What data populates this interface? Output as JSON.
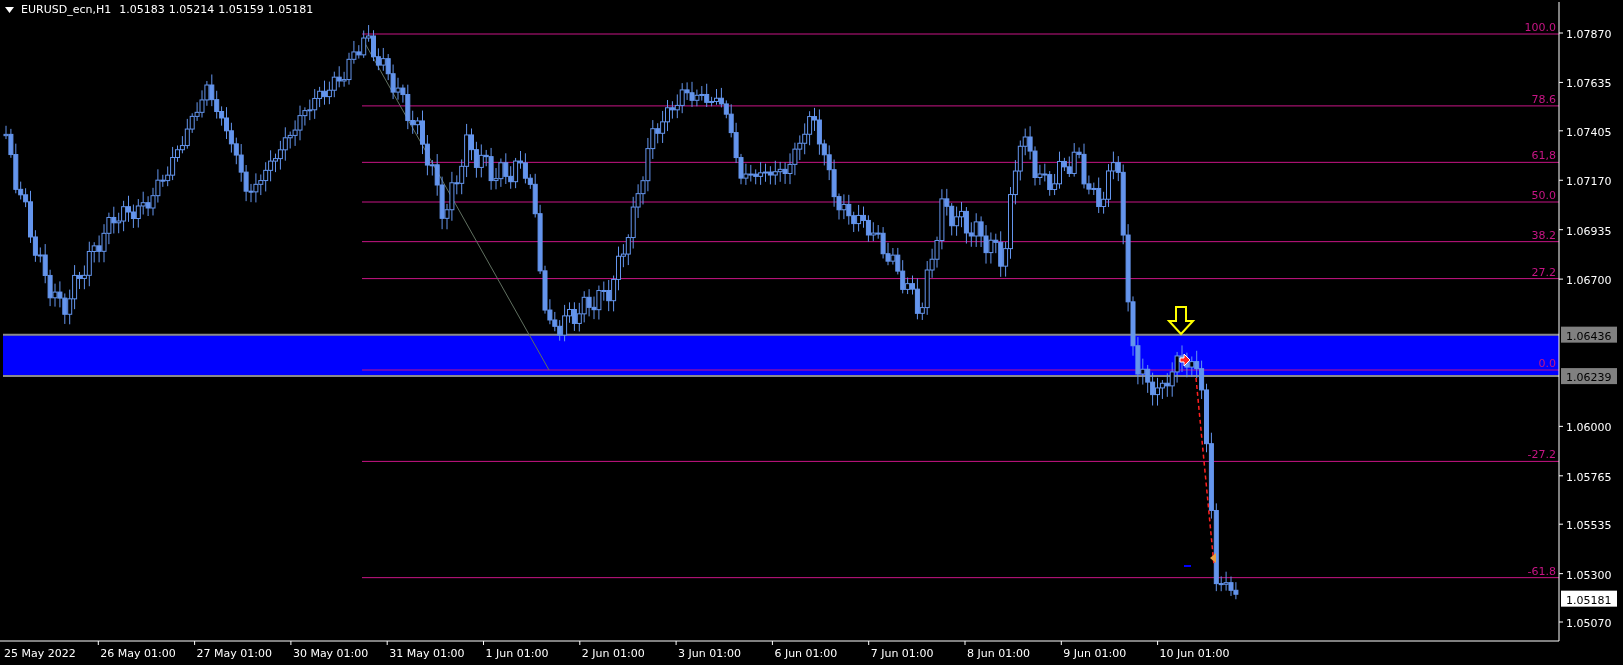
{
  "header": {
    "symbol": "EURUSD_ecn,H1",
    "quotes": [
      "1.05183",
      "1.05214",
      "1.05159",
      "1.05181"
    ]
  },
  "fibonacci_levels": [
    "100.0",
    "78.6",
    "61,8",
    "50.0",
    "38.2",
    "27.2",
    "0.0",
    "-27.2",
    "-61.8"
  ],
  "price_axis": {
    "ticks": [
      "1.07870",
      "1.07635",
      "1.07405",
      "1.07170",
      "1.06935",
      "1.06700",
      "1.06000",
      "1.05765",
      "1.05535",
      "1.05300",
      "1.05070"
    ]
  },
  "price_labels": [
    {
      "text": "1.06436",
      "kind": "line"
    },
    {
      "text": "1.06239",
      "kind": "line"
    },
    {
      "text": "1.05181",
      "kind": "bid"
    }
  ],
  "time_axis": [
    "25 May 2022",
    "26 May 01:00",
    "27 May 01:00",
    "30 May 01:00",
    "31 May 01:00",
    "1 Jun 01:00",
    "2 Jun 01:00",
    "3 Jun 01:00",
    "6 Jun 01:00",
    "7 Jun 01:00",
    "8 Jun 01:00",
    "9 Jun 01:00",
    "10 Jun 01:00"
  ]
}
